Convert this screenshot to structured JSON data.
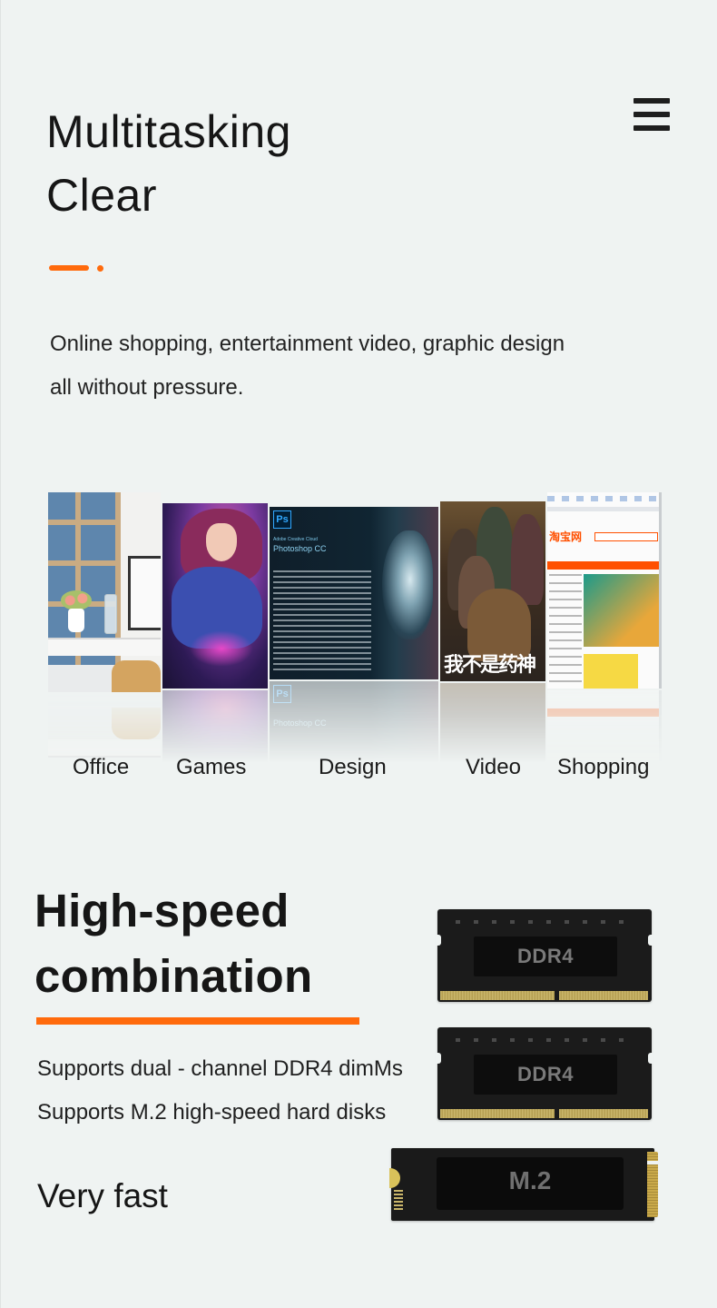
{
  "header": {
    "title_lines": [
      "Multitasking",
      "Clear"
    ],
    "menu_icon": "hamburger-menu-icon"
  },
  "intro": {
    "lines": [
      "Online shopping, entertainment video, graphic design",
      "all without pressure."
    ]
  },
  "gallery": {
    "items": [
      {
        "label": "Office",
        "image": "office-desk-photo"
      },
      {
        "label": "Games",
        "image": "game-character-artwork"
      },
      {
        "label": "Design",
        "image": "photoshop-splash-screen"
      },
      {
        "label": "Video",
        "image": "movie-poster"
      },
      {
        "label": "Shopping",
        "image": "shopping-website-screenshot"
      }
    ],
    "design_splash": {
      "logo": "Ps",
      "subtitle": "Adobe Creative Cloud",
      "product": "Photoshop CC"
    },
    "video_poster_title": "我不是药神",
    "shopping_logo": "淘宝网"
  },
  "high_speed": {
    "title_lines": [
      "High-speed",
      "combination"
    ],
    "features": [
      "Supports dual - channel DDR4 dimMs",
      "Supports M.2 high-speed hard disks"
    ],
    "tagline": "Very fast"
  },
  "hardware": {
    "ram_modules": [
      {
        "label": "DDR4"
      },
      {
        "label": "DDR4"
      }
    ],
    "ssd": {
      "label": "M.2"
    }
  },
  "colors": {
    "accent": "#ff6a0c",
    "background": "#eff3f2",
    "text": "#161616"
  }
}
